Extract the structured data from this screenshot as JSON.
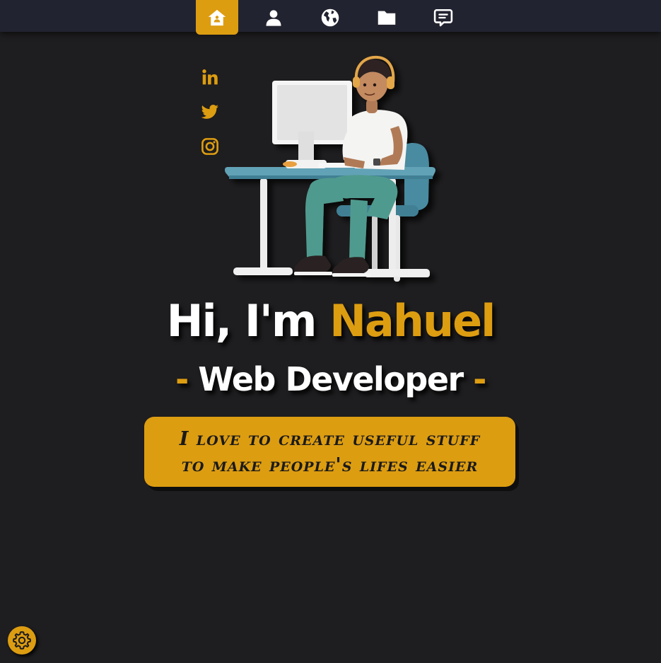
{
  "nav": {
    "items": [
      {
        "name": "home",
        "icon": "home-icon",
        "active": true
      },
      {
        "name": "about",
        "icon": "user-icon",
        "active": false
      },
      {
        "name": "skills",
        "icon": "globe-icon",
        "active": false
      },
      {
        "name": "projects",
        "icon": "folder-icon",
        "active": false
      },
      {
        "name": "contact",
        "icon": "message-icon",
        "active": false
      }
    ]
  },
  "social": {
    "items": [
      {
        "name": "linkedin",
        "icon": "linkedin-icon"
      },
      {
        "name": "twitter",
        "icon": "twitter-icon"
      },
      {
        "name": "instagram",
        "icon": "instagram-icon"
      }
    ]
  },
  "hero": {
    "greeting_prefix": "Hi, I'm",
    "name": "Nahuel",
    "role_dash_left": "-",
    "role": "Web Developer",
    "role_dash_right": "-",
    "illustration": "developer-at-desk-illustration"
  },
  "tagline": {
    "line1": "I love to create useful stuff",
    "line2": "to make people's lifes easier"
  },
  "settings": {
    "icon": "gear-icon"
  },
  "colors": {
    "accent": "#dd9d11",
    "background": "#1e1d1f",
    "navbar": "#222330",
    "text": "#ffffff"
  }
}
